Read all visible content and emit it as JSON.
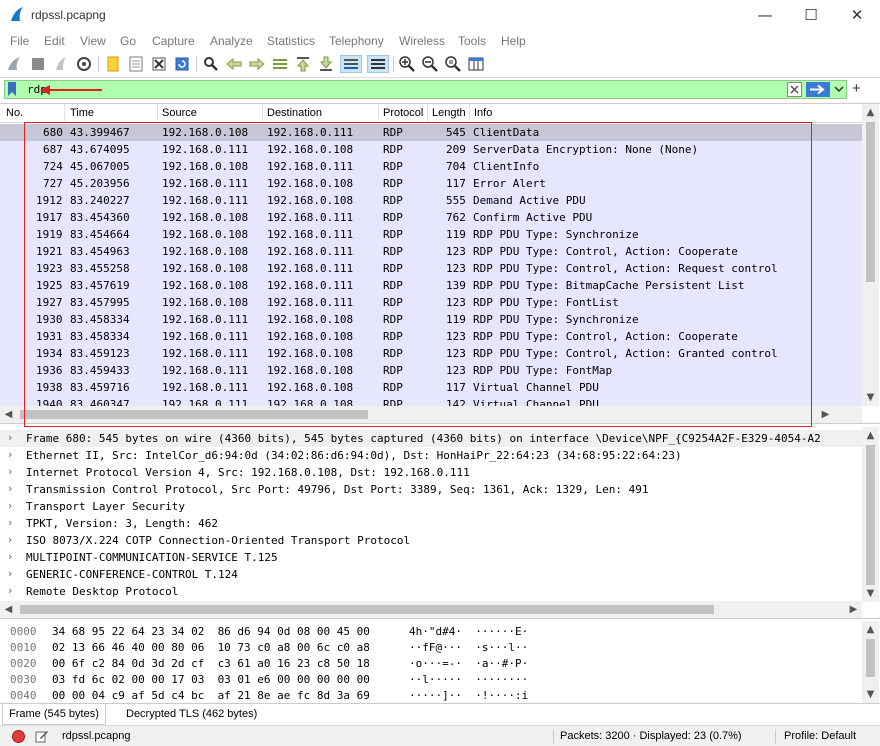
{
  "window": {
    "title": "rdpssl.pcapng",
    "minimize_icon": "minimize-icon",
    "maximize_icon": "maximize-icon",
    "close_icon": "close-icon"
  },
  "menu": [
    "File",
    "Edit",
    "View",
    "Go",
    "Capture",
    "Analyze",
    "Statistics",
    "Telephony",
    "Wireless",
    "Tools",
    "Help"
  ],
  "toolbar_icons": [
    "start-capture-icon",
    "stop-capture-icon",
    "restart-capture-icon",
    "capture-options-icon",
    "open-file-icon",
    "save-file-icon",
    "close-file-icon",
    "reload-file-icon",
    "find-packet-icon",
    "go-back-icon",
    "go-forward-icon",
    "go-to-packet-icon",
    "go-first-icon",
    "go-last-icon",
    "autoscroll-icon",
    "colorize-icon",
    "zoom-in-icon",
    "zoom-out-icon",
    "normal-size-icon",
    "resize-columns-icon"
  ],
  "filter": {
    "value": "rdp",
    "bookmark_icon": "bookmark-icon",
    "clear_icon": "clear-filter-icon",
    "apply_icon": "apply-filter-arrow-icon",
    "dropdown_icon": "chevron-down-icon",
    "add_icon": "plus-icon",
    "annotation_color": "#e02020",
    "background_color": "#afffaf"
  },
  "packet_list": {
    "columns": [
      "No.",
      "Time",
      "Source",
      "Destination",
      "Protocol",
      "Length",
      "Info"
    ],
    "row_color": "#e7e6ff",
    "selected_color": "#c6c6d6",
    "rows": [
      {
        "no": "680",
        "time": "43.399467",
        "src": "192.168.0.108",
        "dst": "192.168.0.111",
        "proto": "RDP",
        "len": "545",
        "info": "ClientData"
      },
      {
        "no": "687",
        "time": "43.674095",
        "src": "192.168.0.111",
        "dst": "192.168.0.108",
        "proto": "RDP",
        "len": "209",
        "info": "ServerData Encryption: None (None)"
      },
      {
        "no": "724",
        "time": "45.067005",
        "src": "192.168.0.108",
        "dst": "192.168.0.111",
        "proto": "RDP",
        "len": "704",
        "info": "ClientInfo"
      },
      {
        "no": "727",
        "time": "45.203956",
        "src": "192.168.0.111",
        "dst": "192.168.0.108",
        "proto": "RDP",
        "len": "117",
        "info": "Error Alert"
      },
      {
        "no": "1912",
        "time": "83.240227",
        "src": "192.168.0.111",
        "dst": "192.168.0.108",
        "proto": "RDP",
        "len": "555",
        "info": "Demand Active PDU"
      },
      {
        "no": "1917",
        "time": "83.454360",
        "src": "192.168.0.108",
        "dst": "192.168.0.111",
        "proto": "RDP",
        "len": "762",
        "info": "Confirm Active PDU"
      },
      {
        "no": "1919",
        "time": "83.454664",
        "src": "192.168.0.108",
        "dst": "192.168.0.111",
        "proto": "RDP",
        "len": "119",
        "info": "RDP PDU Type: Synchronize"
      },
      {
        "no": "1921",
        "time": "83.454963",
        "src": "192.168.0.108",
        "dst": "192.168.0.111",
        "proto": "RDP",
        "len": "123",
        "info": "RDP PDU Type: Control, Action: Cooperate"
      },
      {
        "no": "1923",
        "time": "83.455258",
        "src": "192.168.0.108",
        "dst": "192.168.0.111",
        "proto": "RDP",
        "len": "123",
        "info": "RDP PDU Type: Control, Action: Request control"
      },
      {
        "no": "1925",
        "time": "83.457619",
        "src": "192.168.0.108",
        "dst": "192.168.0.111",
        "proto": "RDP",
        "len": "139",
        "info": "RDP PDU Type: BitmapCache Persistent List"
      },
      {
        "no": "1927",
        "time": "83.457995",
        "src": "192.168.0.108",
        "dst": "192.168.0.111",
        "proto": "RDP",
        "len": "123",
        "info": "RDP PDU Type: FontList"
      },
      {
        "no": "1930",
        "time": "83.458334",
        "src": "192.168.0.111",
        "dst": "192.168.0.108",
        "proto": "RDP",
        "len": "119",
        "info": "RDP PDU Type: Synchronize"
      },
      {
        "no": "1931",
        "time": "83.458334",
        "src": "192.168.0.111",
        "dst": "192.168.0.108",
        "proto": "RDP",
        "len": "123",
        "info": "RDP PDU Type: Control, Action: Cooperate"
      },
      {
        "no": "1934",
        "time": "83.459123",
        "src": "192.168.0.111",
        "dst": "192.168.0.108",
        "proto": "RDP",
        "len": "123",
        "info": "RDP PDU Type: Control, Action: Granted control"
      },
      {
        "no": "1936",
        "time": "83.459433",
        "src": "192.168.0.111",
        "dst": "192.168.0.108",
        "proto": "RDP",
        "len": "123",
        "info": "RDP PDU Type: FontMap"
      },
      {
        "no": "1938",
        "time": "83.459716",
        "src": "192.168.0.111",
        "dst": "192.168.0.108",
        "proto": "RDP",
        "len": "117",
        "info": "Virtual Channel PDU"
      },
      {
        "no": "1940",
        "time": "83.460347",
        "src": "192.168.0.111",
        "dst": "192.168.0.108",
        "proto": "RDP",
        "len": "142",
        "info": "Virtual Channel PDU"
      }
    ]
  },
  "details": [
    "Frame 680: 545 bytes on wire (4360 bits), 545 bytes captured (4360 bits) on interface \\Device\\NPF_{C9254A2F-E329-4054-A2",
    "Ethernet II, Src: IntelCor_d6:94:0d (34:02:86:d6:94:0d), Dst: HonHaiPr_22:64:23 (34:68:95:22:64:23)",
    "Internet Protocol Version 4, Src: 192.168.0.108, Dst: 192.168.0.111",
    "Transmission Control Protocol, Src Port: 49796, Dst Port: 3389, Seq: 1361, Ack: 1329, Len: 491",
    "Transport Layer Security",
    "TPKT, Version: 3, Length: 462",
    "ISO 8073/X.224 COTP Connection-Oriented Transport Protocol",
    "MULTIPOINT-COMMUNICATION-SERVICE T.125",
    "GENERIC-CONFERENCE-CONTROL T.124",
    "Remote Desktop Protocol"
  ],
  "hex": [
    {
      "offset": "0000",
      "bytes": "34 68 95 22 64 23 34 02  86 d6 94 0d 08 00 45 00",
      "ascii": "4h·\"d#4·  ······E·"
    },
    {
      "offset": "0010",
      "bytes": "02 13 66 46 40 00 80 06  10 73 c0 a8 00 6c c0 a8",
      "ascii": "··fF@···  ·s···l··"
    },
    {
      "offset": "0020",
      "bytes": "00 6f c2 84 0d 3d 2d cf  c3 61 a0 16 23 c8 50 18",
      "ascii": "·o···=-·  ·a··#·P·"
    },
    {
      "offset": "0030",
      "bytes": "03 fd 6c 02 00 00 17 03  03 01 e6 00 00 00 00 00",
      "ascii": "··l·····  ········"
    },
    {
      "offset": "0040",
      "bytes": "00 00 04 c9 af 5d c4 bc  af 21 8e ae fc 8d 3a 69",
      "ascii": "·····]··  ·!····:i"
    }
  ],
  "byte_tabs": [
    "Frame (545 bytes)",
    "Decrypted TLS (462 bytes)"
  ],
  "status": {
    "file": "rdpssl.pcapng",
    "packets": "Packets: 3200 · Displayed: 23 (0.7%)",
    "profile": "Profile: Default"
  }
}
